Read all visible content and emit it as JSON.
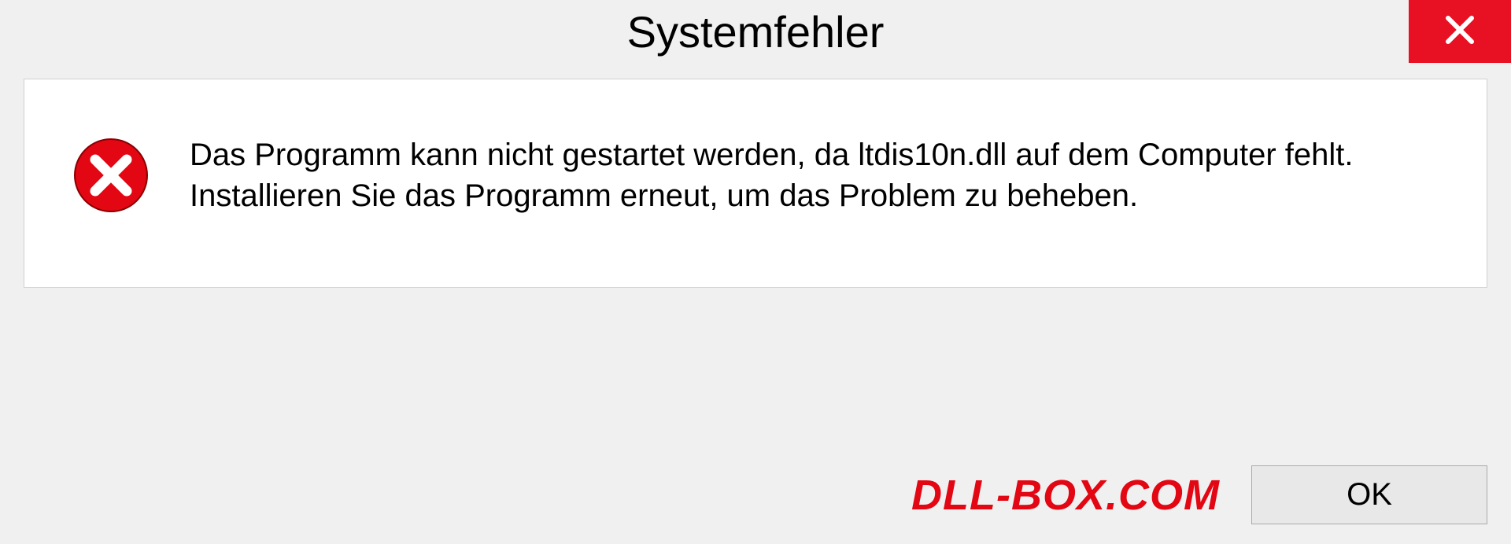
{
  "dialog": {
    "title": "Systemfehler",
    "message": "Das Programm kann nicht gestartet werden, da ltdis10n.dll auf dem Computer fehlt. Installieren Sie das Programm erneut, um das Problem zu beheben.",
    "ok_label": "OK"
  },
  "watermark": "DLL-BOX.COM"
}
